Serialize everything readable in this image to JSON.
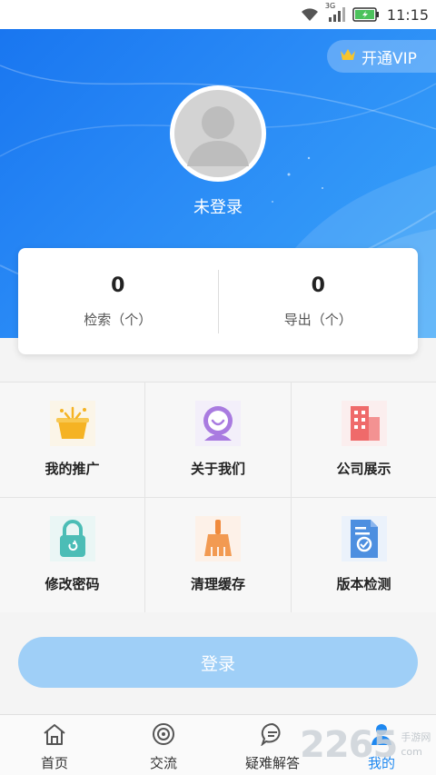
{
  "status_bar": {
    "network": "3G",
    "time": "11:15"
  },
  "header": {
    "vip_label": "开通VIP",
    "login_state": "未登录"
  },
  "stats": [
    {
      "value": "0",
      "label": "检索（个）"
    },
    {
      "value": "0",
      "label": "导出（个）"
    }
  ],
  "menu": [
    {
      "label": "我的推广",
      "icon": "promotion-basket-icon"
    },
    {
      "label": "关于我们",
      "icon": "smiley-face-icon"
    },
    {
      "label": "公司展示",
      "icon": "building-icon"
    },
    {
      "label": "修改密码",
      "icon": "lock-icon"
    },
    {
      "label": "清理缓存",
      "icon": "broom-icon"
    },
    {
      "label": "版本检测",
      "icon": "document-check-icon"
    }
  ],
  "login_button": "登录",
  "bottom_nav": [
    {
      "label": "首页",
      "icon": "home-icon"
    },
    {
      "label": "交流",
      "icon": "target-icon"
    },
    {
      "label": "疑难解答",
      "icon": "chat-bubble-icon"
    },
    {
      "label": "我的",
      "icon": "person-icon",
      "active": true
    }
  ],
  "watermark": {
    "number": "2265",
    "text_top": "手游网",
    "text_bottom": "com"
  },
  "colors": {
    "primary": "#1e88f0",
    "login_button": "#9fcff7"
  }
}
